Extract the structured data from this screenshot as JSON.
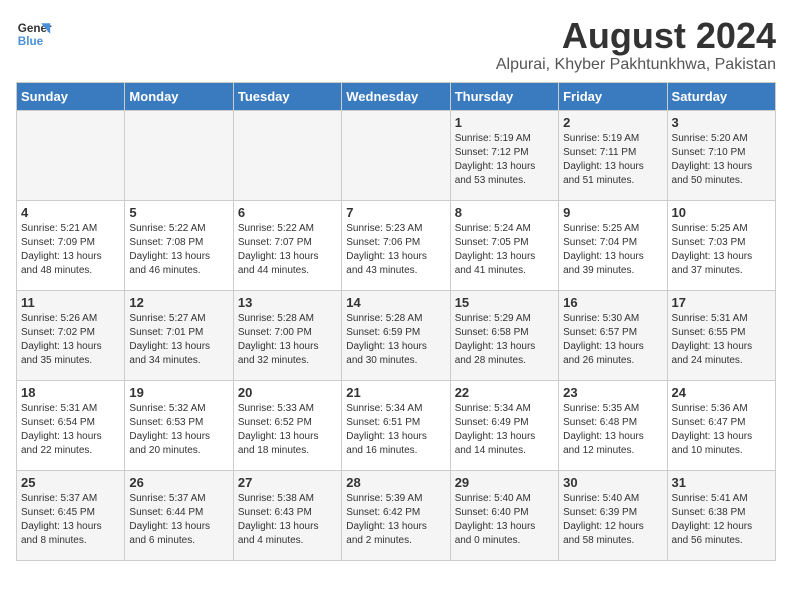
{
  "header": {
    "logo_line1": "General",
    "logo_line2": "Blue",
    "title": "August 2024",
    "subtitle": "Alpurai, Khyber Pakhtunkhwa, Pakistan"
  },
  "days_of_week": [
    "Sunday",
    "Monday",
    "Tuesday",
    "Wednesday",
    "Thursday",
    "Friday",
    "Saturday"
  ],
  "weeks": [
    [
      {
        "num": "",
        "info": ""
      },
      {
        "num": "",
        "info": ""
      },
      {
        "num": "",
        "info": ""
      },
      {
        "num": "",
        "info": ""
      },
      {
        "num": "1",
        "info": "Sunrise: 5:19 AM\nSunset: 7:12 PM\nDaylight: 13 hours\nand 53 minutes."
      },
      {
        "num": "2",
        "info": "Sunrise: 5:19 AM\nSunset: 7:11 PM\nDaylight: 13 hours\nand 51 minutes."
      },
      {
        "num": "3",
        "info": "Sunrise: 5:20 AM\nSunset: 7:10 PM\nDaylight: 13 hours\nand 50 minutes."
      }
    ],
    [
      {
        "num": "4",
        "info": "Sunrise: 5:21 AM\nSunset: 7:09 PM\nDaylight: 13 hours\nand 48 minutes."
      },
      {
        "num": "5",
        "info": "Sunrise: 5:22 AM\nSunset: 7:08 PM\nDaylight: 13 hours\nand 46 minutes."
      },
      {
        "num": "6",
        "info": "Sunrise: 5:22 AM\nSunset: 7:07 PM\nDaylight: 13 hours\nand 44 minutes."
      },
      {
        "num": "7",
        "info": "Sunrise: 5:23 AM\nSunset: 7:06 PM\nDaylight: 13 hours\nand 43 minutes."
      },
      {
        "num": "8",
        "info": "Sunrise: 5:24 AM\nSunset: 7:05 PM\nDaylight: 13 hours\nand 41 minutes."
      },
      {
        "num": "9",
        "info": "Sunrise: 5:25 AM\nSunset: 7:04 PM\nDaylight: 13 hours\nand 39 minutes."
      },
      {
        "num": "10",
        "info": "Sunrise: 5:25 AM\nSunset: 7:03 PM\nDaylight: 13 hours\nand 37 minutes."
      }
    ],
    [
      {
        "num": "11",
        "info": "Sunrise: 5:26 AM\nSunset: 7:02 PM\nDaylight: 13 hours\nand 35 minutes."
      },
      {
        "num": "12",
        "info": "Sunrise: 5:27 AM\nSunset: 7:01 PM\nDaylight: 13 hours\nand 34 minutes."
      },
      {
        "num": "13",
        "info": "Sunrise: 5:28 AM\nSunset: 7:00 PM\nDaylight: 13 hours\nand 32 minutes."
      },
      {
        "num": "14",
        "info": "Sunrise: 5:28 AM\nSunset: 6:59 PM\nDaylight: 13 hours\nand 30 minutes."
      },
      {
        "num": "15",
        "info": "Sunrise: 5:29 AM\nSunset: 6:58 PM\nDaylight: 13 hours\nand 28 minutes."
      },
      {
        "num": "16",
        "info": "Sunrise: 5:30 AM\nSunset: 6:57 PM\nDaylight: 13 hours\nand 26 minutes."
      },
      {
        "num": "17",
        "info": "Sunrise: 5:31 AM\nSunset: 6:55 PM\nDaylight: 13 hours\nand 24 minutes."
      }
    ],
    [
      {
        "num": "18",
        "info": "Sunrise: 5:31 AM\nSunset: 6:54 PM\nDaylight: 13 hours\nand 22 minutes."
      },
      {
        "num": "19",
        "info": "Sunrise: 5:32 AM\nSunset: 6:53 PM\nDaylight: 13 hours\nand 20 minutes."
      },
      {
        "num": "20",
        "info": "Sunrise: 5:33 AM\nSunset: 6:52 PM\nDaylight: 13 hours\nand 18 minutes."
      },
      {
        "num": "21",
        "info": "Sunrise: 5:34 AM\nSunset: 6:51 PM\nDaylight: 13 hours\nand 16 minutes."
      },
      {
        "num": "22",
        "info": "Sunrise: 5:34 AM\nSunset: 6:49 PM\nDaylight: 13 hours\nand 14 minutes."
      },
      {
        "num": "23",
        "info": "Sunrise: 5:35 AM\nSunset: 6:48 PM\nDaylight: 13 hours\nand 12 minutes."
      },
      {
        "num": "24",
        "info": "Sunrise: 5:36 AM\nSunset: 6:47 PM\nDaylight: 13 hours\nand 10 minutes."
      }
    ],
    [
      {
        "num": "25",
        "info": "Sunrise: 5:37 AM\nSunset: 6:45 PM\nDaylight: 13 hours\nand 8 minutes."
      },
      {
        "num": "26",
        "info": "Sunrise: 5:37 AM\nSunset: 6:44 PM\nDaylight: 13 hours\nand 6 minutes."
      },
      {
        "num": "27",
        "info": "Sunrise: 5:38 AM\nSunset: 6:43 PM\nDaylight: 13 hours\nand 4 minutes."
      },
      {
        "num": "28",
        "info": "Sunrise: 5:39 AM\nSunset: 6:42 PM\nDaylight: 13 hours\nand 2 minutes."
      },
      {
        "num": "29",
        "info": "Sunrise: 5:40 AM\nSunset: 6:40 PM\nDaylight: 13 hours\nand 0 minutes."
      },
      {
        "num": "30",
        "info": "Sunrise: 5:40 AM\nSunset: 6:39 PM\nDaylight: 12 hours\nand 58 minutes."
      },
      {
        "num": "31",
        "info": "Sunrise: 5:41 AM\nSunset: 6:38 PM\nDaylight: 12 hours\nand 56 minutes."
      }
    ]
  ]
}
